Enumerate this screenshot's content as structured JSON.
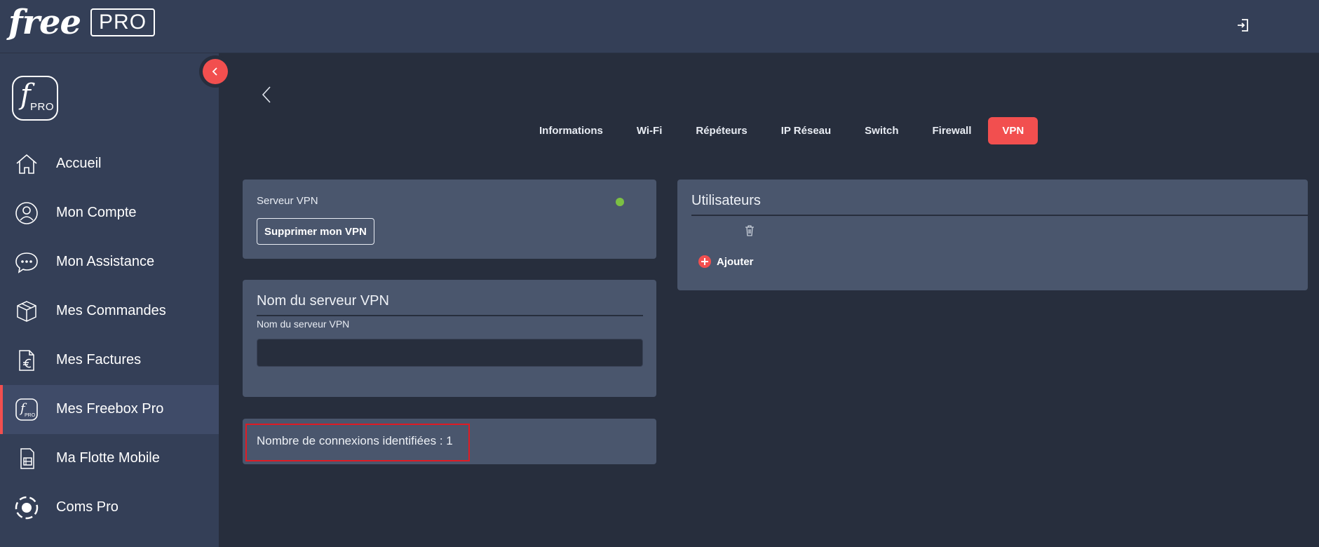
{
  "header": {
    "brand_word": "free",
    "brand_badge": "PRO",
    "logout_icon": "logout-icon"
  },
  "sidebar": {
    "logo_letter": "f",
    "logo_text": "PRO",
    "items": [
      {
        "label": "Accueil",
        "icon": "home-icon"
      },
      {
        "label": "Mon Compte",
        "icon": "user-icon"
      },
      {
        "label": "Mon Assistance",
        "icon": "chat-icon"
      },
      {
        "label": "Mes Commandes",
        "icon": "box-icon"
      },
      {
        "label": "Mes Factures",
        "icon": "invoice-euro-icon"
      },
      {
        "label": "Mes Freebox Pro",
        "icon": "freebox-pro-icon",
        "active": true
      },
      {
        "label": "Ma Flotte Mobile",
        "icon": "sim-card-icon"
      },
      {
        "label": "Coms Pro",
        "icon": "coms-pro-icon"
      }
    ]
  },
  "tabs": [
    {
      "label": "Informations"
    },
    {
      "label": "Wi-Fi"
    },
    {
      "label": "Répéteurs"
    },
    {
      "label": "IP Réseau"
    },
    {
      "label": "Switch"
    },
    {
      "label": "Firewall"
    },
    {
      "label": "VPN",
      "active": true
    }
  ],
  "vpn_server": {
    "label": "Serveur VPN",
    "status_color": "#7cc043",
    "delete_button": "Supprimer mon VPN"
  },
  "server_name": {
    "title": "Nom du serveur VPN",
    "field_label": "Nom du serveur VPN",
    "value": ""
  },
  "connections": {
    "text": "Nombre de connexions identifiées : 1"
  },
  "users": {
    "title": "Utilisateurs",
    "add_label": "Ajouter"
  },
  "colors": {
    "accent": "#f24f4f",
    "background": "#272e3d",
    "sidebar": "#343f57",
    "card": "#4a566d"
  }
}
